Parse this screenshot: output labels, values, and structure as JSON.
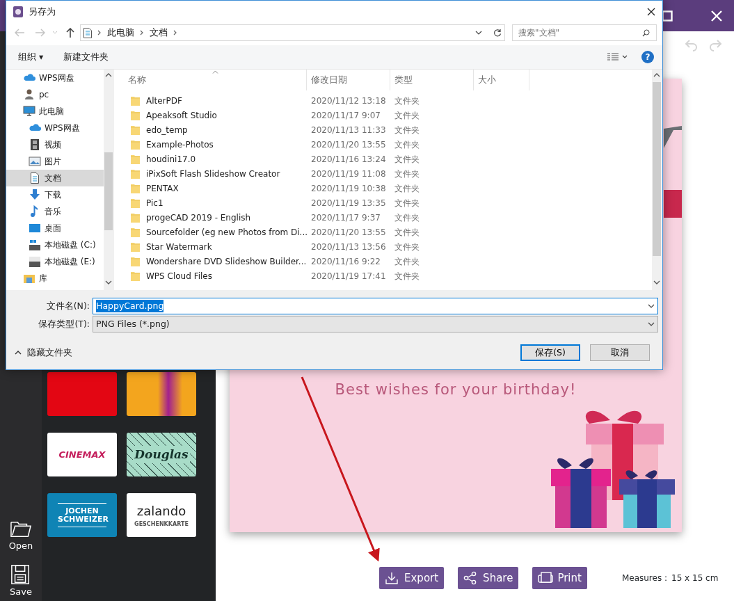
{
  "app": {
    "rail": [
      {
        "kind": "open",
        "label": "Open"
      },
      {
        "kind": "save",
        "label": "Save"
      }
    ],
    "gift_cards": [
      {
        "kind": "solid"
      },
      {
        "kind": "paint"
      },
      {
        "kind": "cinemax",
        "logo": "CINEMAX"
      },
      {
        "kind": "douglas",
        "logo": "Douglas"
      },
      {
        "kind": "jochen",
        "logo": "JOCHEN SCHWEIZER"
      },
      {
        "kind": "zalando",
        "logo": "zalando",
        "subtitle": "GESCHENKKARTE"
      }
    ],
    "greeting": "Best wishes for your birthday!",
    "actions": [
      {
        "kind": "export",
        "label": "Export"
      },
      {
        "kind": "share",
        "label": "Share"
      },
      {
        "kind": "print",
        "label": "Print"
      }
    ],
    "measures": {
      "label": "Measures :",
      "value": "15 x 15 cm"
    }
  },
  "dialog": {
    "title": "另存为",
    "breadcrumb": [
      "此电脑",
      "文档"
    ],
    "search": {
      "placeholder": "搜索\"文档\""
    },
    "toolbar": {
      "organize": "组织 ▾",
      "new_folder": "新建文件夹",
      "help": "?"
    },
    "nav": [
      {
        "kind": "cloud",
        "label": "WPS网盘",
        "selected": false
      },
      {
        "kind": "user",
        "label": "pc",
        "selected": false
      },
      {
        "kind": "computer",
        "label": "此电脑",
        "selected": false,
        "children": [
          {
            "kind": "cloud",
            "label": "WPS网盘",
            "selected": false
          },
          {
            "kind": "video",
            "label": "视频",
            "selected": false
          },
          {
            "kind": "picture",
            "label": "图片",
            "selected": false
          },
          {
            "kind": "document",
            "label": "文档",
            "selected": true
          },
          {
            "kind": "download",
            "label": "下载",
            "selected": false
          },
          {
            "kind": "music",
            "label": "音乐",
            "selected": false
          },
          {
            "kind": "desktop",
            "label": "桌面",
            "selected": false
          },
          {
            "kind": "drive_c",
            "label": "本地磁盘 (C:)",
            "selected": false
          },
          {
            "kind": "drive",
            "label": "本地磁盘 (E:)",
            "selected": false
          }
        ]
      },
      {
        "kind": "library",
        "label": "库",
        "selected": false
      }
    ],
    "columns": [
      "名称",
      "修改日期",
      "类型",
      "大小"
    ],
    "files": [
      {
        "name": "AlterPDF",
        "date": "2020/11/12 13:18",
        "type": "文件夹"
      },
      {
        "name": "Apeaksoft Studio",
        "date": "2020/11/17 9:07",
        "type": "文件夹"
      },
      {
        "name": "edo_temp",
        "date": "2020/11/13 11:33",
        "type": "文件夹"
      },
      {
        "name": "Example-Photos",
        "date": "2020/11/20 13:55",
        "type": "文件夹"
      },
      {
        "name": "houdini17.0",
        "date": "2020/11/16 13:24",
        "type": "文件夹"
      },
      {
        "name": "iPixSoft Flash Slideshow Creator",
        "date": "2020/11/19 11:08",
        "type": "文件夹"
      },
      {
        "name": "PENTAX",
        "date": "2020/11/19 10:38",
        "type": "文件夹"
      },
      {
        "name": "Pic1",
        "date": "2020/11/19 13:35",
        "type": "文件夹"
      },
      {
        "name": "progeCAD 2019 - English",
        "date": "2020/11/17 9:37",
        "type": "文件夹"
      },
      {
        "name": "Sourcefolder (eg new Photos from Di...",
        "date": "2020/11/20 13:55",
        "type": "文件夹"
      },
      {
        "name": "Star Watermark",
        "date": "2020/11/13 13:56",
        "type": "文件夹"
      },
      {
        "name": "Wondershare DVD Slideshow Builder...",
        "date": "2020/11/16 9:22",
        "type": "文件夹"
      },
      {
        "name": "WPS Cloud Files",
        "date": "2020/11/19 17:41",
        "type": "文件夹"
      }
    ],
    "filename": {
      "label": "文件名(N):",
      "value": "HappyCard.png",
      "text_selected": true
    },
    "filetype": {
      "label": "保存类型(T):",
      "value": "PNG Files (*.png)"
    },
    "hide_folders": "隐藏文件夹",
    "buttons": [
      {
        "kind": "primary",
        "label": "保存(S)"
      },
      {
        "kind": "normal",
        "label": "取消"
      }
    ]
  }
}
